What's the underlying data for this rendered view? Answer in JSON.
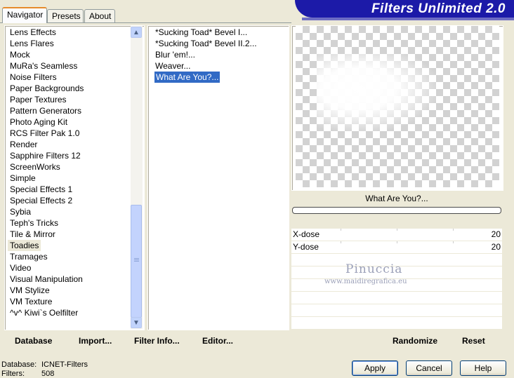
{
  "tabs": [
    {
      "label": "Navigator",
      "active": true
    },
    {
      "label": "Presets",
      "active": false
    },
    {
      "label": "About",
      "active": false
    }
  ],
  "app_title": "Filters Unlimited 2.0",
  "categories": [
    "Lens Effects",
    "Lens Flares",
    "Mock",
    "MuRa's Seamless",
    "Noise Filters",
    "Paper Backgrounds",
    "Paper Textures",
    "Pattern Generators",
    "Photo Aging Kit",
    "RCS Filter Pak 1.0",
    "Render",
    "Sapphire Filters 12",
    "ScreenWorks",
    "Simple",
    "Special Effects 1",
    "Special Effects 2",
    "Sybia",
    "Teph's Tricks",
    "Tile & Mirror",
    "Toadies",
    "Tramages",
    "Video",
    "Visual Manipulation",
    "VM Stylize",
    "VM Texture",
    "^v^ Kiwi`s Oelfilter"
  ],
  "selected_category": "Toadies",
  "filters": [
    "*Sucking Toad*  Bevel I...",
    "*Sucking Toad*  Bevel II.2...",
    "Blur 'em!...",
    "Weaver...",
    "What Are You?..."
  ],
  "selected_filter": "What Are You?...",
  "preview": {
    "filter_name": "What Are You?..."
  },
  "params": [
    {
      "label": "X-dose",
      "value": "20"
    },
    {
      "label": "Y-dose",
      "value": "20"
    }
  ],
  "watermark": {
    "name": "Pinuccia",
    "url": "www.maidiregrafica.eu"
  },
  "left_buttons": {
    "database": "Database",
    "import": "Import...",
    "filter_info": "Filter Info...",
    "editor": "Editor..."
  },
  "right_buttons": {
    "randomize": "Randomize",
    "reset": "Reset"
  },
  "status": {
    "database_label": "Database:",
    "database_value": "ICNET-Filters",
    "filters_label": "Filters:",
    "filters_value": "508"
  },
  "dialog_buttons": {
    "apply": "Apply",
    "cancel": "Cancel",
    "help": "Help"
  },
  "colors": {
    "accent": "#1c1aa8",
    "selection": "#316ac5",
    "tab_highlight": "#e68b2c"
  }
}
